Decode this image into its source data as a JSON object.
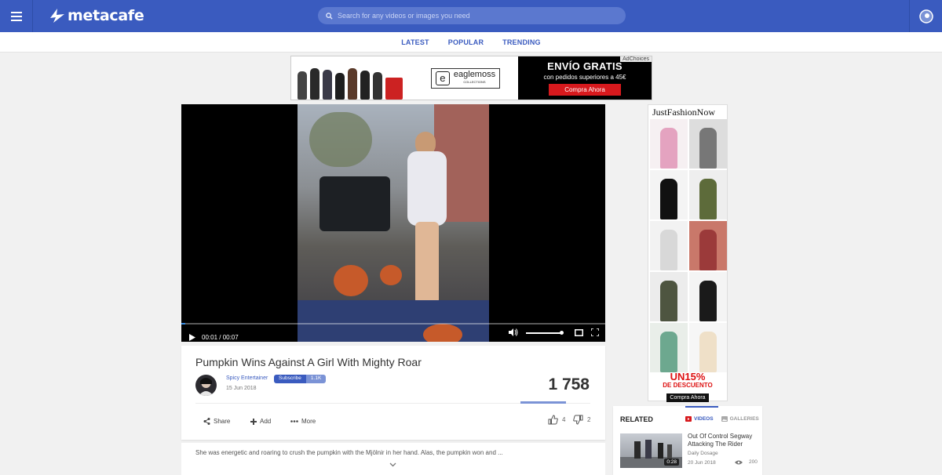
{
  "header": {
    "logo_text": "metacafe",
    "search_placeholder": "Search for any videos or images you need"
  },
  "subnav": {
    "items": [
      "LATEST",
      "POPULAR",
      "TRENDING"
    ]
  },
  "ad_top": {
    "brand": "eaglemoss",
    "brand_sub": "COLLECTIONS",
    "headline": "ENVÍO GRATIS",
    "subline": "con pedidos superiores a 45€",
    "cta": "Compra Ahora",
    "adchoices": "AdChoices"
  },
  "player": {
    "time": "00:01 / 00:07",
    "progress": 0.01,
    "volume": 1.0
  },
  "video": {
    "title": "Pumpkin Wins Against A Girl With Mighty Roar",
    "channel": "Spicy Entertainer",
    "date": "15 Jun 2018",
    "subscribe_label": "Subscribe",
    "subscriber_count": "1.1K",
    "views": "1 758",
    "share_label": "Share",
    "add_label": "Add",
    "more_label": "More",
    "likes": "4",
    "dislikes": "2",
    "description": "She was energetic and roaring to crush the pumpkin with the Mjölnir in her hand. Alas, the pumpkin won and ..."
  },
  "side_ad": {
    "brand": "JustFashionNow",
    "promo_line1": "UN15%",
    "promo_line2": "DE DESCUENTO",
    "cta": "Compra Ahora"
  },
  "related": {
    "heading": "RELATED",
    "tab_videos": "VIDEOS",
    "tab_galleries": "GALLERIES",
    "items": [
      {
        "title": "Out Of Control Segway Attacking The Rider",
        "channel": "Daily Dosage",
        "date": "20 Jun 2018",
        "views": "200",
        "duration": "0:28"
      }
    ]
  },
  "colors": {
    "brand_blue": "#3a5bbf",
    "ad_red": "#d7191d"
  }
}
